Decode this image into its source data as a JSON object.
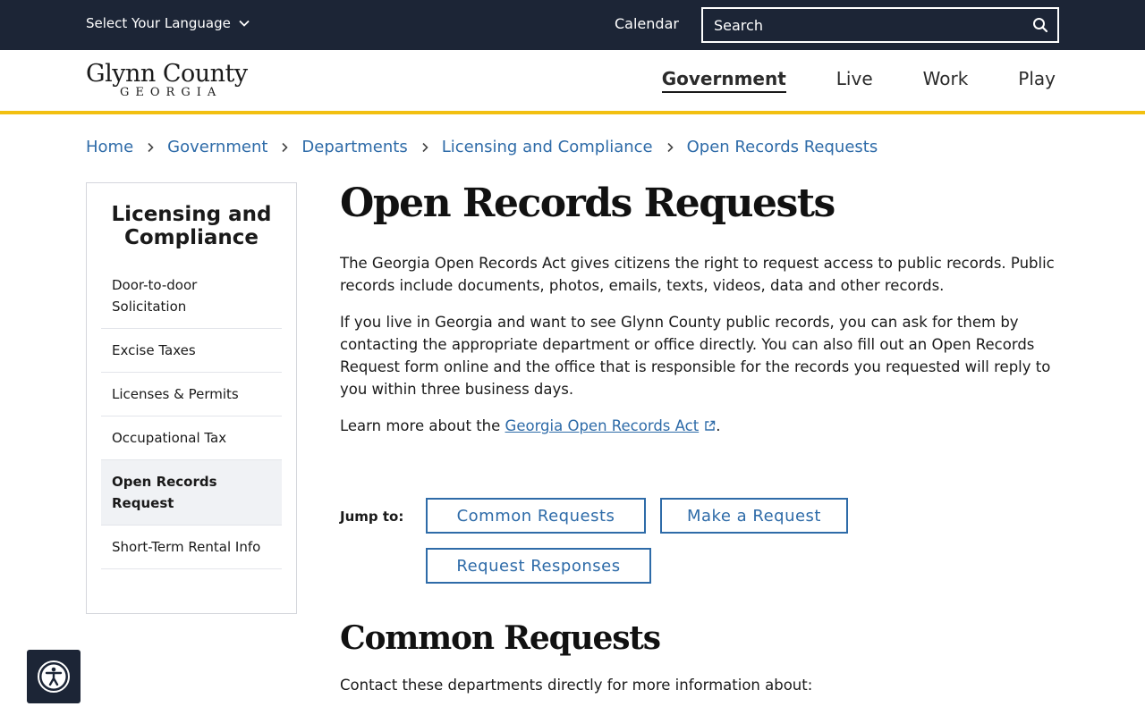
{
  "utility": {
    "language_label": "Select Your Language",
    "calendar_label": "Calendar",
    "search_placeholder": "Search"
  },
  "header": {
    "logo_main": "Glynn County",
    "logo_sub": "GEORGIA",
    "nav": [
      {
        "label": "Government",
        "active": true
      },
      {
        "label": "Live"
      },
      {
        "label": "Work"
      },
      {
        "label": "Play"
      }
    ]
  },
  "breadcrumb": [
    "Home",
    "Government",
    "Departments",
    "Licensing and Compliance",
    "Open Records Requests"
  ],
  "sidebar": {
    "title": "Licensing and Compliance",
    "items": [
      {
        "label": "Door-to-door Solicitation"
      },
      {
        "label": "Excise Taxes"
      },
      {
        "label": "Licenses & Permits"
      },
      {
        "label": "Occupational Tax"
      },
      {
        "label": "Open Records Request",
        "active": true
      },
      {
        "label": "Short-Term Rental Info"
      }
    ]
  },
  "content": {
    "title": "Open Records Requests",
    "para1": "The Georgia Open Records Act gives citizens the right to request access to public records. Public records include documents, photos, emails, texts, videos, data and other records.",
    "para2": "If you live in Georgia and want to see Glynn County public records, you can ask for them by contacting the appropriate department or office directly. You can also fill out an Open Records Request form online and the office that is responsible for the records you requested will reply to you within three business days.",
    "para3_prefix": "Learn more about the ",
    "para3_link": "Georgia Open Records Act",
    "para3_suffix": ".",
    "jump_label": "Jump to:",
    "jump_buttons": [
      "Common Requests",
      "Make a Request",
      "Request Responses"
    ],
    "section_title": "Common Requests",
    "section_text": "Contact these departments directly for more information about:"
  },
  "colors": {
    "utility_bg": "#1c2536",
    "accent_yellow": "#f2c010",
    "link_blue": "#2e6ba8"
  },
  "icons": {
    "language": "chevron-down-icon",
    "search": "search-icon",
    "breadcrumb_separator": "chevron-right-icon",
    "external_link": "external-link-icon",
    "accessibility": "accessibility-icon"
  }
}
